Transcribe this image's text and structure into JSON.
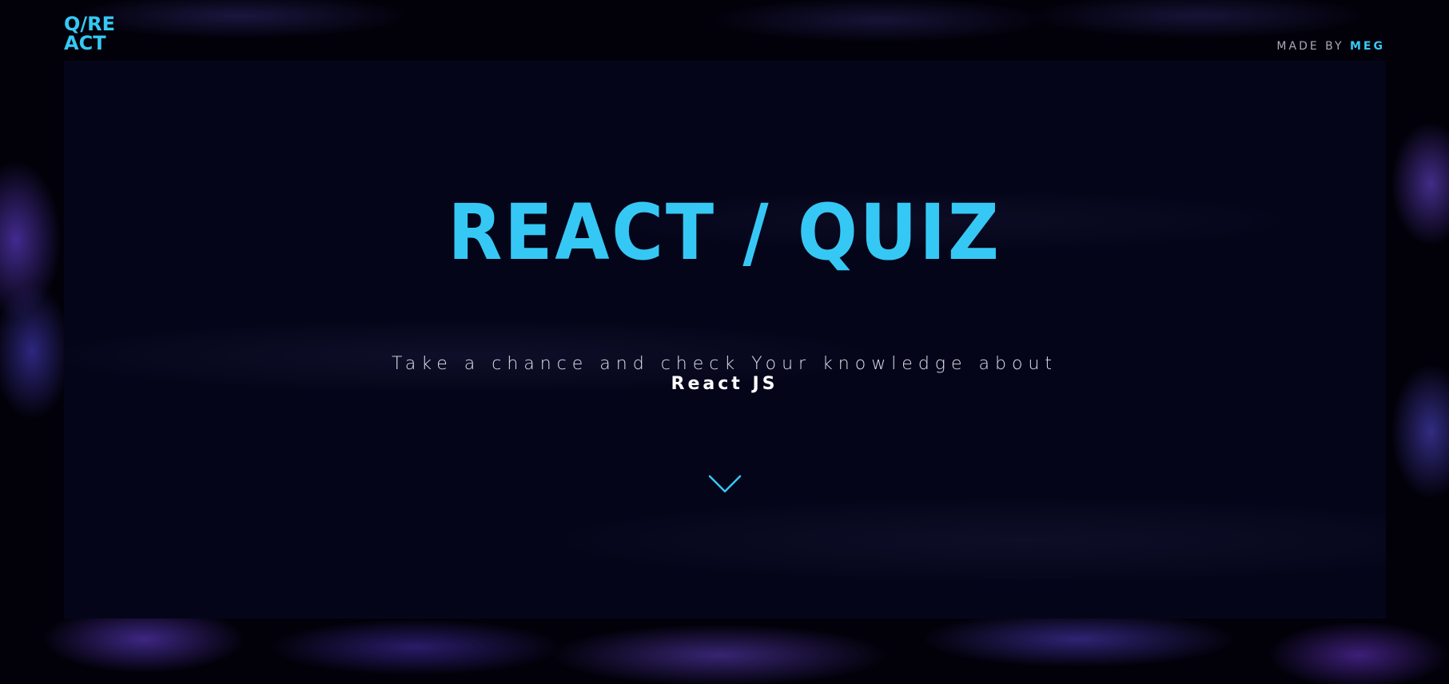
{
  "header": {
    "logo_line1": "Q/RE",
    "logo_line2": "ACT",
    "credit_prefix": "MADE BY",
    "credit_author": "MEG"
  },
  "hero": {
    "title": "REACT / QUIZ",
    "tagline": "Take a chance and check Your knowledge about",
    "subject": "React JS",
    "scroll_icon": "chevron-down-icon"
  },
  "colors": {
    "accent": "#36c8f4",
    "background": "#02010a",
    "panel": "#05051a",
    "text_muted": "#a9abb8"
  }
}
